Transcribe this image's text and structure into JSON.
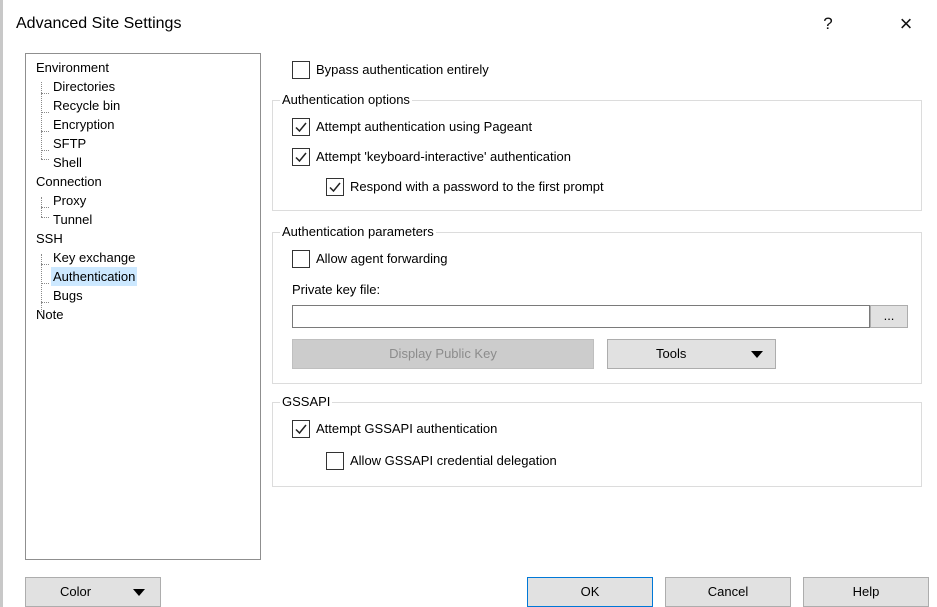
{
  "window": {
    "title": "Advanced Site Settings",
    "help_glyph": "?",
    "close_glyph": "×"
  },
  "tree": {
    "items": [
      {
        "label": "Environment"
      },
      {
        "label": "Directories"
      },
      {
        "label": "Recycle bin"
      },
      {
        "label": "Encryption"
      },
      {
        "label": "SFTP"
      },
      {
        "label": "Shell"
      },
      {
        "label": "Connection"
      },
      {
        "label": "Proxy"
      },
      {
        "label": "Tunnel"
      },
      {
        "label": "SSH"
      },
      {
        "label": "Key exchange"
      },
      {
        "label": "Authentication",
        "selected": true
      },
      {
        "label": "Bugs"
      },
      {
        "label": "Note"
      }
    ]
  },
  "bypass": {
    "label": "Bypass authentication entirely",
    "checked": false
  },
  "auth_options": {
    "title": "Authentication options",
    "pageant": {
      "label": "Attempt authentication using Pageant",
      "checked": true
    },
    "keyboard": {
      "label": "Attempt 'keyboard-interactive' authentication",
      "checked": true
    },
    "respond": {
      "label": "Respond with a password to the first prompt",
      "checked": true
    }
  },
  "auth_params": {
    "title": "Authentication parameters",
    "agent_forwarding": {
      "label": "Allow agent forwarding",
      "checked": false
    },
    "private_key_label": "Private key file:",
    "private_key_value": "",
    "browse_label": "...",
    "display_public_key_label": "Display Public Key",
    "tools_label": "Tools"
  },
  "gssapi": {
    "title": "GSSAPI",
    "attempt": {
      "label": "Attempt GSSAPI authentication",
      "checked": true
    },
    "delegation": {
      "label": "Allow GSSAPI credential delegation",
      "checked": false
    }
  },
  "footer": {
    "color_label": "Color",
    "ok_label": "OK",
    "cancel_label": "Cancel",
    "help_label": "Help"
  },
  "colors": {
    "selection": "#cce8ff",
    "default_button_border": "#0078d7"
  }
}
